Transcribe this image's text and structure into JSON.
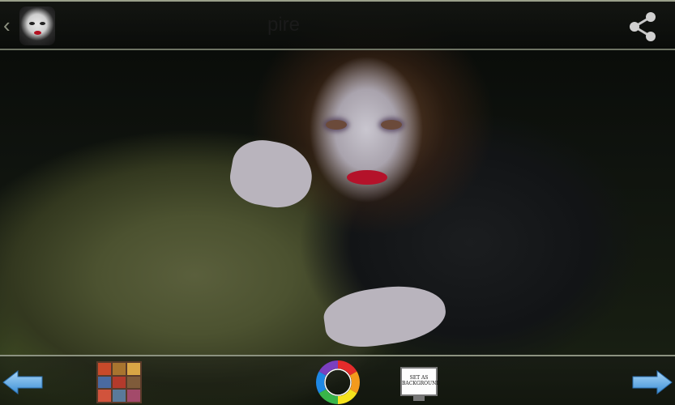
{
  "header": {
    "title": "",
    "title_visible_fragment": "pire",
    "back_icon": "chevron-left-icon",
    "app_icon": "vampire-face-icon",
    "share_icon": "share-icon"
  },
  "toolbar": {
    "prev_icon": "arrow-left-icon",
    "gallery_icon": "gallery-grid-icon",
    "color_icon": "color-wheel-icon",
    "background_label": "SET AS BACKGROUND",
    "next_icon": "arrow-right-icon"
  },
  "colors": {
    "arrow_blue": "#5aa7e6",
    "bar_dark": "#0e100c"
  }
}
